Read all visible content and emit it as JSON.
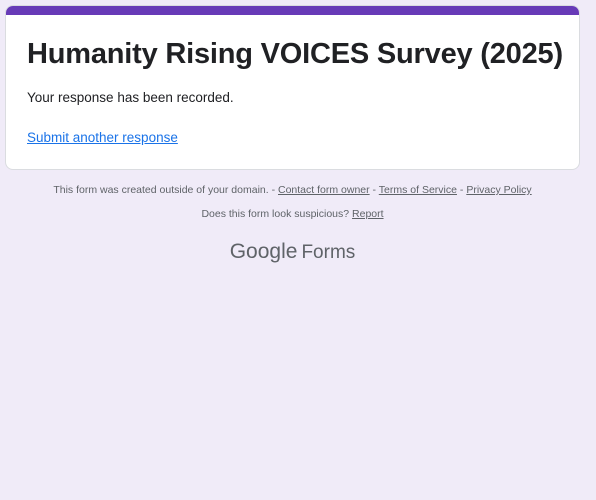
{
  "form": {
    "title": "Humanity Rising VOICES Survey (2025)",
    "confirmation_message": "Your response has been recorded.",
    "submit_another_label": "Submit another response"
  },
  "footer": {
    "domain_notice": "This form was created outside of your domain. -",
    "contact_owner_label": "Contact form owner",
    "separator": "-",
    "terms_label": "Terms of Service",
    "privacy_label": "Privacy Policy",
    "suspicious_question": "Does this form look suspicious?",
    "report_label": "Report"
  },
  "brand": {
    "google": "Google",
    "forms": "Forms"
  },
  "colors": {
    "accent": "#673ab7",
    "page_background": "#f0ebf8",
    "link": "#1a73e8"
  }
}
